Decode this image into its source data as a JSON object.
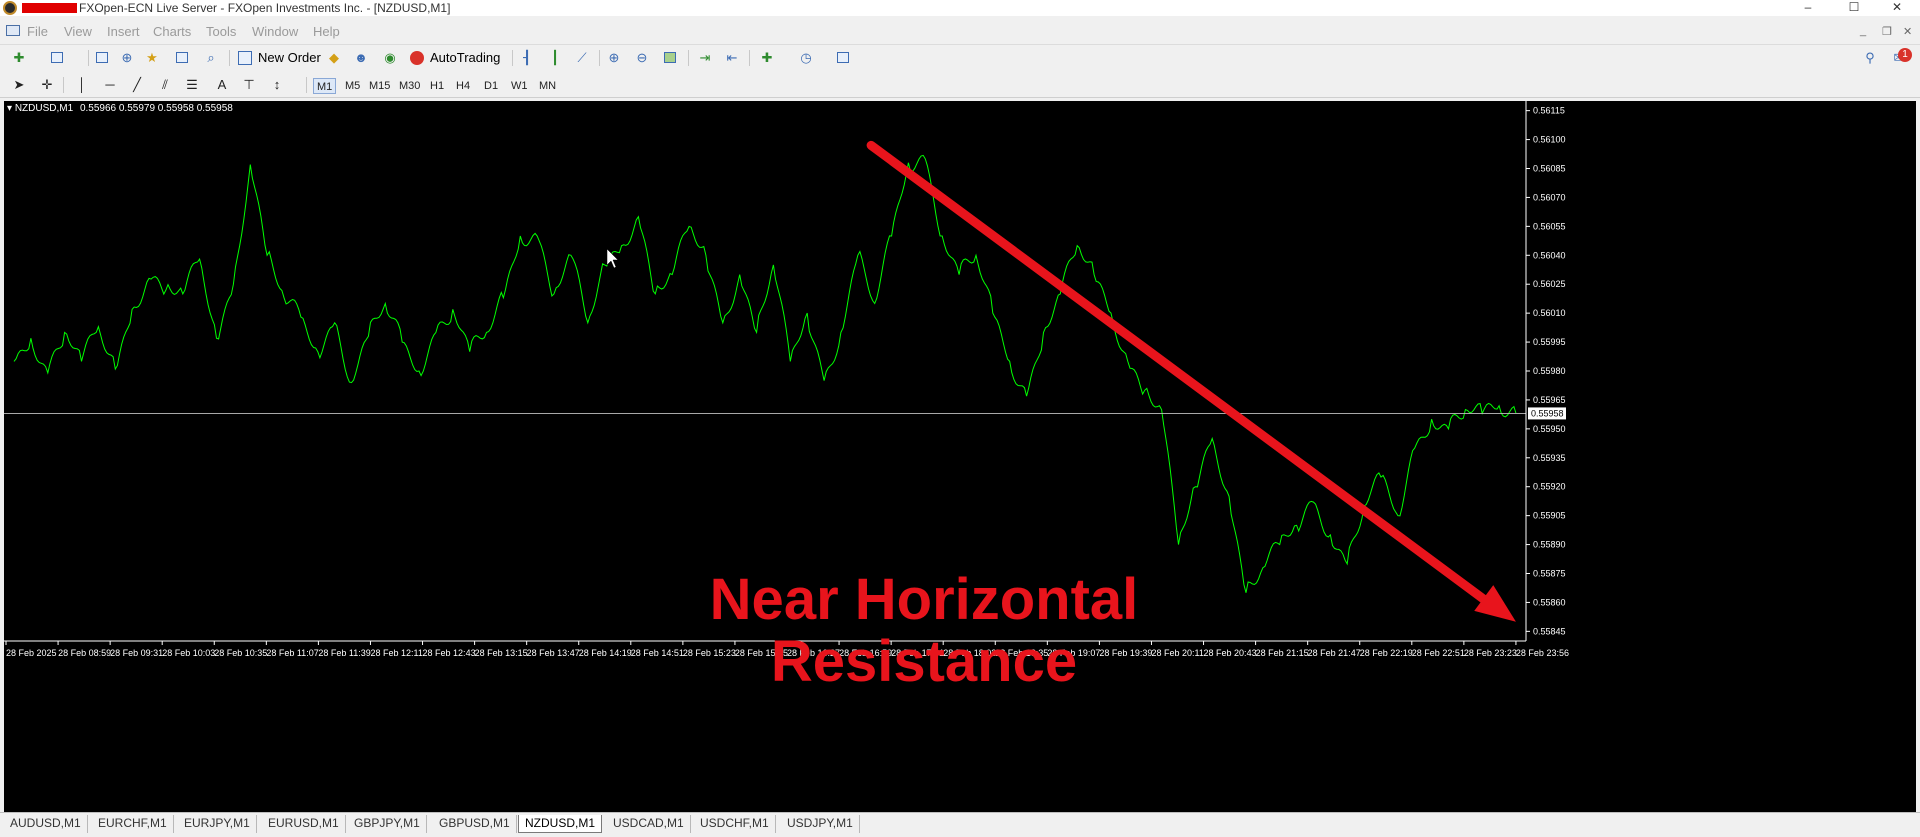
{
  "window": {
    "title": "FXOpen-ECN Live Server - FXOpen Investments Inc. - [NZDUSD,M1]",
    "controls": [
      "–",
      "☐",
      "✕"
    ]
  },
  "menubar": {
    "items": [
      "File",
      "View",
      "Insert",
      "Charts",
      "Tools",
      "Window",
      "Help"
    ],
    "notification_count": "1"
  },
  "toolbar": {
    "new_order_label": "New Order",
    "autotrading_label": "AutoTrading"
  },
  "timeframes": {
    "items": [
      "M1",
      "M5",
      "M15",
      "M30",
      "H1",
      "H4",
      "D1",
      "W1",
      "MN"
    ],
    "active": "M1"
  },
  "chart": {
    "header_symbol": "NZDUSD,M1",
    "header_quotes": "0.55966 0.55979 0.55958 0.55958",
    "bid_label": "0.55958",
    "annotation_line1": "Near Horizontal",
    "annotation_line2": "Resistance",
    "colors": {
      "background": "#000000",
      "price_line": "#00ff00",
      "annotation": "#e8141c",
      "axis_text": "#ffffff",
      "horizontal_line": "#c0c0c0"
    }
  },
  "chart_data": {
    "type": "line",
    "symbol": "NZDUSD",
    "timeframe": "M1",
    "y_ticks": [
      0.56115,
      0.561,
      0.56085,
      0.5607,
      0.56055,
      0.5604,
      0.56025,
      0.5601,
      0.55995,
      0.5598,
      0.55965,
      0.5595,
      0.55935,
      0.5592,
      0.55905,
      0.5589,
      0.55875,
      0.5586,
      0.55845
    ],
    "ylim": [
      0.5584,
      0.5612
    ],
    "x_ticks": [
      "28 Feb 2025",
      "28 Feb 08:59",
      "28 Feb 09:31",
      "28 Feb 10:03",
      "28 Feb 10:35",
      "28 Feb 11:07",
      "28 Feb 11:39",
      "28 Feb 12:11",
      "28 Feb 12:43",
      "28 Feb 13:15",
      "28 Feb 13:47",
      "28 Feb 14:19",
      "28 Feb 14:51",
      "28 Feb 15:23",
      "28 Feb 15:55",
      "28 Feb 16:27",
      "28 Feb 16:59",
      "28 Feb 17:31",
      "28 Feb 18:03",
      "28 Feb 18:35",
      "28 Feb 19:07",
      "28 Feb 19:39",
      "28 Feb 20:11",
      "28 Feb 20:43",
      "28 Feb 21:15",
      "28 Feb 21:47",
      "28 Feb 22:19",
      "28 Feb 22:51",
      "28 Feb 23:23",
      "28 Feb 23:56"
    ],
    "series": [
      {
        "x": [
          0,
          1,
          2,
          3,
          4,
          5,
          6,
          7,
          8,
          9,
          10,
          11,
          12,
          13,
          14,
          15,
          16,
          17,
          18,
          19,
          20,
          21,
          22,
          23,
          24,
          25,
          26,
          27,
          28,
          29,
          30,
          31,
          32,
          33,
          34,
          35,
          36,
          37,
          38,
          39,
          40,
          41,
          42,
          43,
          44,
          45,
          46,
          47,
          48,
          49,
          50,
          51,
          52,
          53,
          54,
          55,
          56,
          57,
          58,
          59
        ],
        "values": [
          0.55985,
          0.55997,
          0.55979,
          0.56,
          0.55985,
          0.56003,
          0.55981,
          0.56012,
          0.56028,
          0.56022,
          0.5602,
          0.56038,
          0.55997,
          0.56025,
          0.56087,
          0.5604,
          0.56018,
          0.56008,
          0.5599,
          0.56005,
          0.55974,
          0.55998,
          0.56015,
          0.55995,
          0.5598,
          0.56,
          0.56012,
          0.5599,
          0.56,
          0.56018,
          0.5605,
          0.5605,
          0.5602,
          0.5604,
          0.56005,
          0.56035,
          0.56045,
          0.5606,
          0.5602,
          0.5603,
          0.56055,
          0.5604,
          0.56005,
          0.5603,
          0.56,
          0.56035,
          0.55985,
          0.5601,
          0.55975,
          0.56,
          0.5604,
          0.56015,
          0.5605,
          0.56088,
          0.5609,
          0.5605,
          0.5603,
          0.5604,
          0.5601,
          0.55985
        ],
        "name": ""
      },
      {
        "x": [
          60,
          61,
          62,
          63,
          64,
          65,
          66,
          67,
          68,
          69,
          70,
          71,
          72,
          73,
          74,
          75,
          76,
          77,
          78,
          79,
          80,
          81,
          82,
          83,
          84,
          85,
          86,
          87,
          88,
          89
        ],
        "values": [
          0.55967,
          0.56,
          0.5602,
          0.56045,
          0.5603,
          0.5601,
          0.55985,
          0.5597,
          0.5596,
          0.5589,
          0.5592,
          0.55945,
          0.55915,
          0.55865,
          0.55878,
          0.5589,
          0.559,
          0.55912,
          0.55895,
          0.5588,
          0.5591,
          0.55925,
          0.55905,
          0.5594,
          0.55955,
          0.5595,
          0.5596,
          0.55958,
          0.55962,
          0.55958
        ],
        "name": ""
      }
    ],
    "horizontal_line": 0.55958,
    "trend_arrow": {
      "from": {
        "x": "28 Feb 17:31",
        "y": 0.56097
      },
      "to": {
        "x": "28 Feb 23:56",
        "y": 0.5585
      },
      "color": "#e8141c"
    },
    "annotations": [
      "Near Horizontal",
      "Resistance"
    ],
    "grid": false,
    "legend": "none",
    "title": "NZDUSD,M1",
    "xlabel": "",
    "ylabel": ""
  },
  "tabs": [
    "AUDUSD,M1",
    "EURCHF,M1",
    "EURJPY,M1",
    "EURUSD,M1",
    "GBPJPY,M1",
    "GBPUSD,M1",
    "NZDUSD,M1",
    "USDCAD,M1",
    "USDCHF,M1",
    "USDJPY,M1"
  ],
  "active_tab": "NZDUSD,M1"
}
